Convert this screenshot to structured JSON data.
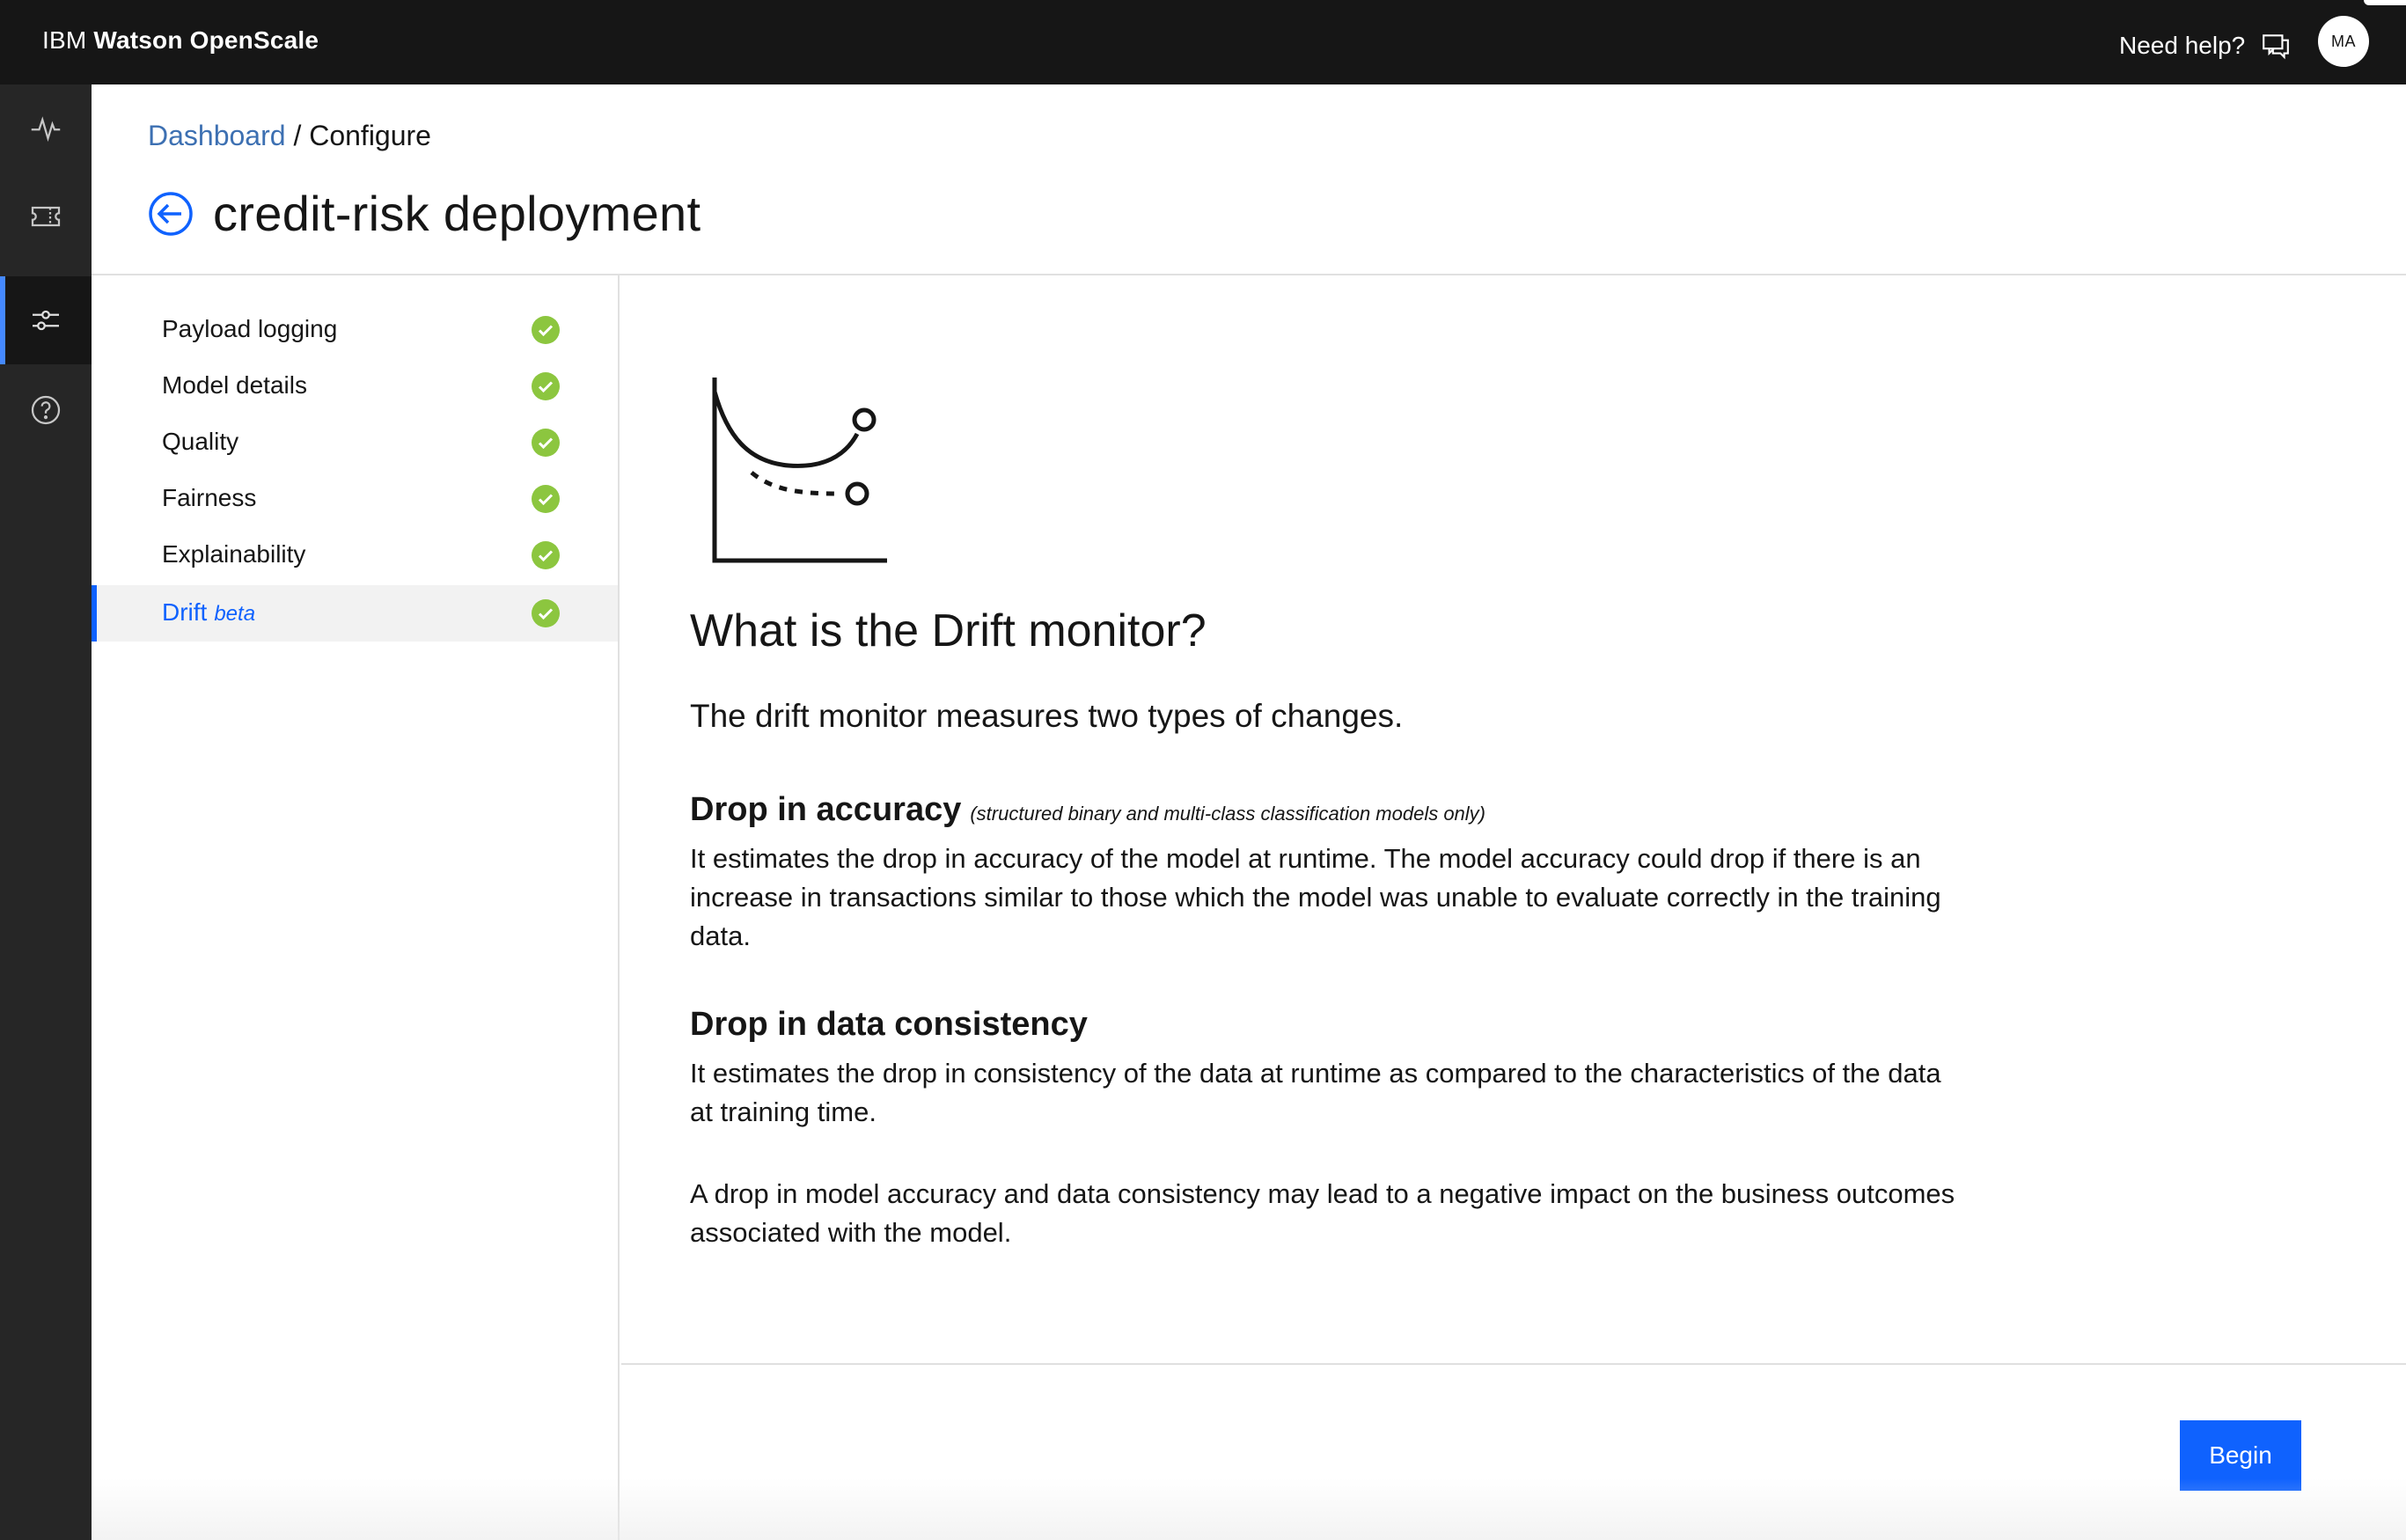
{
  "app": {
    "brand_prefix": "IBM",
    "brand_name": "Watson OpenScale",
    "help_label": "Need help?",
    "avatar_initials": "MA"
  },
  "breadcrumb": {
    "link": "Dashboard",
    "separator": " / ",
    "current": "Configure"
  },
  "page": {
    "title": "credit-risk deployment"
  },
  "leftnav": {
    "items": [
      {
        "icon": "activity-icon"
      },
      {
        "icon": "ticket-icon"
      },
      {
        "icon": "sliders-icon",
        "active": true
      },
      {
        "icon": "help-icon"
      }
    ]
  },
  "steps": [
    {
      "label": "Payload logging",
      "status": "complete"
    },
    {
      "label": "Model details",
      "status": "complete"
    },
    {
      "label": "Quality",
      "status": "complete"
    },
    {
      "label": "Fairness",
      "status": "complete"
    },
    {
      "label": "Explainability",
      "status": "complete"
    },
    {
      "label": "Drift",
      "tag": "beta",
      "status": "complete",
      "active": true
    }
  ],
  "content": {
    "heading": "What is the Drift monitor?",
    "lead": "The drift monitor measures two types of changes.",
    "section1": {
      "title": "Drop in accuracy",
      "note": "(structured binary and multi-class classification models only)",
      "body": "It estimates the drop in accuracy of the model at runtime. The model accuracy could drop if there is an increase in transactions similar to those which the model was unable to evaluate correctly in the training data."
    },
    "section2": {
      "title": "Drop in data consistency",
      "body": "It estimates the drop in consistency of the data at runtime as compared to the characteristics of the data at training time."
    },
    "closing": "A drop in model accuracy and data consistency may lead to a negative impact on the business outcomes associated with the model."
  },
  "footer": {
    "begin_label": "Begin"
  },
  "colors": {
    "topbar": "#161616",
    "sidenav": "#262626",
    "accent": "#0f62fe",
    "link": "#3d70b2",
    "success": "#8cc63f"
  }
}
